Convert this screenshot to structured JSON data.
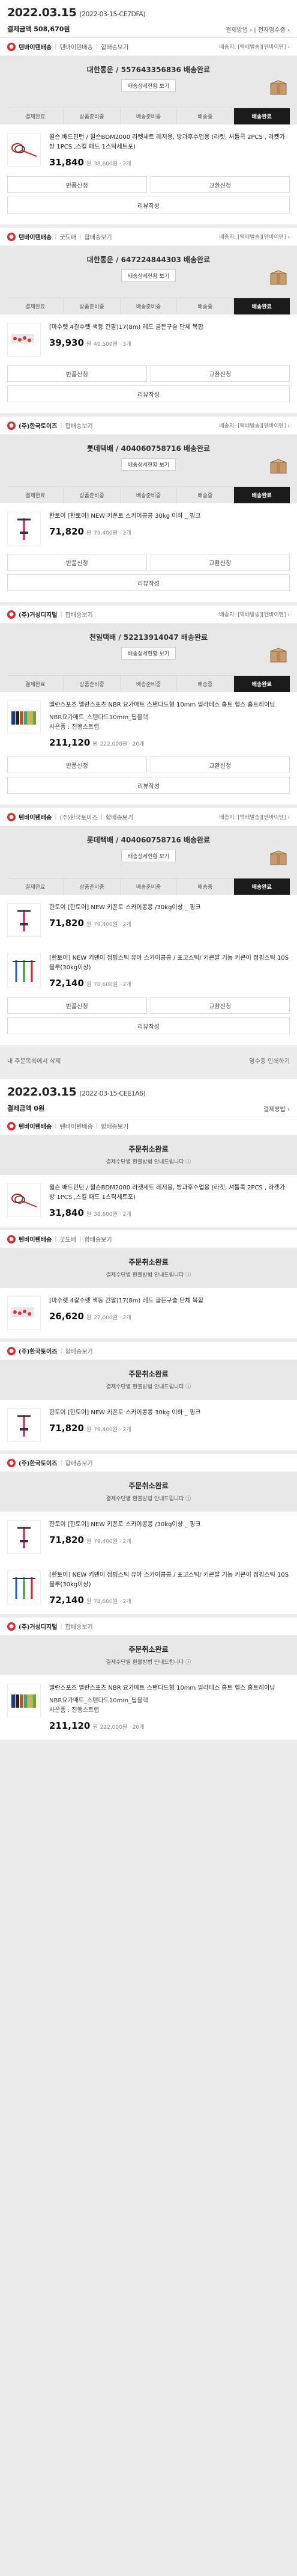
{
  "orders": [
    {
      "date": "2022.03.15",
      "code": "(2022-03-15-CE7DFA)",
      "amount_label": "결제금액 508,670원",
      "links": "결제방법 ›  |  전자영수증 ›",
      "groups": [
        {
          "shop": "텐바이텐배송",
          "shop_sub": "텐바이텐배송",
          "merge": "합배송보기",
          "notice": "배송지: [택배발송][텐바이텐] ›",
          "tracking": "대한통운 / 557643356836 배송완료",
          "track_btn": "배송상세현황 보기",
          "items": [
            {
              "name": "윌슨 배드민턴 / 윌슨BDM2000 라켓세트 레저용, 방과후수업용 (라켓, 셔틀콕 2PCS , 라켓가방 1PCS ,스킬 패드 1스틱세트포)",
              "price": "31,840",
              "orig": "38,600원",
              "qty": "2개"
            }
          ],
          "actions": [
            [
              "반품신청",
              "교환신청"
            ],
            [
              "리뷰작성"
            ]
          ]
        },
        {
          "shop": "텐바이텐배송",
          "shop_sub": "굿도배",
          "merge": "합배송보기",
          "notice": "배송지: [택배발송][텐바이텐] ›",
          "tracking": "대한통운 / 647224844303 배송완료",
          "track_btn": "배송상세현황 보기",
          "items": [
            {
              "name": "[마수렛 4갈수렛 색등 긴팔)17(8m) 레드 골든구슬 단체 복합",
              "price": "39,930",
              "orig": "40,500원",
              "qty": "3개"
            }
          ],
          "actions": [
            [
              "반품신청",
              "교환신청"
            ],
            [
              "리뷰작성"
            ]
          ]
        },
        {
          "shop": "(주)한국토이즈",
          "shop_sub": "",
          "merge": "합배송보기",
          "notice": "배송지: [택배발송][텐바이텐] ›",
          "tracking": "롯데택배 / 404060758716 배송완료",
          "track_btn": "배송상세현황 보기",
          "items": [
            {
              "name": "한토이 [한토이] NEW 키폰토 스카이콩콩 30kg 이하 _ 핑크",
              "price": "71,820",
              "orig": "79,400원",
              "qty": "2개"
            }
          ],
          "actions": [
            [
              "반품신청",
              "교환신청"
            ],
            [
              "리뷰작성"
            ]
          ]
        },
        {
          "shop": "(주)거성디지털",
          "shop_sub": "",
          "merge": "합배송보기",
          "notice": "배송지: [택배발송][텐바이텐] ›",
          "tracking": "천일택배 / 52213914047 배송완료",
          "track_btn": "배송상세현황 보기",
          "items": [
            {
              "name": "엘란스포츠 엘란스포츠 NBR 요가매트 스탠다드형 10mm 필라테스 홈트 헬스 홈트레이닝",
              "opt": "NBR요가매트_스탠다드10mm_딥블랙\n사은품 : 진행스트랩",
              "price": "211,120",
              "orig": "222,000원",
              "qty": "20개"
            }
          ],
          "actions": [
            [
              "반품신청",
              "교환신청"
            ],
            [
              "리뷰작성"
            ]
          ]
        },
        {
          "shop": "텐바이텐배송",
          "shop_sub": "(주)한국토이즈",
          "merge": "합배송보기",
          "notice": "배송지: [택배발송][텐바이텐] ›",
          "tracking": "롯데택배 / 404060758716 배송완료",
          "track_btn": "배송상세현황 보기",
          "items": [
            {
              "name": "한토이 [한토이] NEW 키폰토 스카이콩콩 /30kg이상 _ 핑크",
              "price": "71,820",
              "orig": "79,400원",
              "qty": "2개"
            },
            {
              "name": "[한토이] NEW 키덴이 점핑스틱 유아 스카이콩콩 / 포고스틱/ 키큰발 기능 키큰이 점핑스틱 10S 블루(30kg이상)",
              "price": "72,140",
              "orig": "78,600원",
              "qty": "2개"
            }
          ],
          "actions": [
            [
              "반품신청",
              "교환신청"
            ],
            [
              "리뷰작성"
            ]
          ]
        }
      ],
      "footer_left": "내 주문목록에서 삭제",
      "footer_right": "영수증 인쇄하기"
    },
    {
      "date": "2022.03.15",
      "code": "(2022-03-15-CEE1A6)",
      "amount_label": "결제금액 0원",
      "links": "결제방법 ›",
      "groups": [
        {
          "shop": "텐바이텐배송",
          "shop_sub": "텐바이텐배송",
          "merge": "합배송보기",
          "notice": "",
          "cancel_title": "주문취소완료",
          "cancel_sub": "결제수단별 환불방법 안내드립니다 ⓘ",
          "items": [
            {
              "name": "윌슨 배드민턴 / 윌슨BDM2000 라켓세트 레저용, 방과후수업용 (라켓, 셔틀콕 2PCS , 라켓가방 1PCS ,스킬 패드 1스틱세트포)",
              "price": "31,840",
              "orig": "38,600원",
              "qty": "2개"
            }
          ]
        },
        {
          "shop": "텐바이텐배송",
          "shop_sub": "굿도배",
          "merge": "합배송보기",
          "notice": "",
          "cancel_title": "주문취소완료",
          "cancel_sub": "결제수단별 환불방법 안내드립니다 ⓘ",
          "items": [
            {
              "name": "[마수렛 4갈수렛 색등 긴팔)17(8m) 레드 골든구슬 단체 복합",
              "price": "26,620",
              "orig": "27,000원",
              "qty": "2개"
            }
          ]
        },
        {
          "shop": "(주)한국토이즈",
          "shop_sub": "",
          "merge": "합배송보기",
          "notice": "",
          "cancel_title": "주문취소완료",
          "cancel_sub": "결제수단별 환불방법 안내드립니다 ⓘ",
          "items": [
            {
              "name": "한토이 [한토이] NEW 키폰토 스카이콩콩 30kg 이하 _ 핑크",
              "price": "71,820",
              "orig": "79,400원",
              "qty": "2개"
            }
          ]
        },
        {
          "shop": "(주)한국토이즈",
          "shop_sub": "",
          "merge": "합배송보기",
          "notice": "",
          "cancel_title": "주문취소완료",
          "cancel_sub": "결제수단별 환불방법 안내드립니다 ⓘ",
          "items": [
            {
              "name": "한토이 [한토이] NEW 키폰토 스카이콩콩 /30kg이상 _ 핑크",
              "price": "71,820",
              "orig": "79,400원",
              "qty": "2개"
            },
            {
              "name": "[한토이] NEW 키덴이 점핑스틱 유아 스카이콩콩 / 포고스틱/ 키큰발 기능 키큰이 점핑스틱 10S 블루(30kg이상)",
              "price": "72,140",
              "orig": "78,600원",
              "qty": "2개"
            }
          ]
        },
        {
          "shop": "(주)거성디지털",
          "shop_sub": "",
          "merge": "합배송보기",
          "notice": "",
          "cancel_title": "주문취소완료",
          "cancel_sub": "결제수단별 환불방법 안내드립니다 ⓘ",
          "items": [
            {
              "name": "엘란스포츠 엘란스포츠 NBR 요가매트 스탠다드형 10mm 필라테스 홈트 헬스 홈트레이닝",
              "opt": "NBR요가매트_스탠다드10mm_딥블랙\n사은품 : 진행스트랩",
              "price": "211,120",
              "orig": "222,000원",
              "qty": "20개"
            }
          ]
        }
      ]
    }
  ],
  "steps": [
    "결제완료",
    "상품준비중",
    "배송준비중",
    "배송중",
    "배송완료"
  ],
  "currency_suffix": "원",
  "colors": {
    "accent": "#e1292f",
    "active_step": "#1b1b1b"
  }
}
